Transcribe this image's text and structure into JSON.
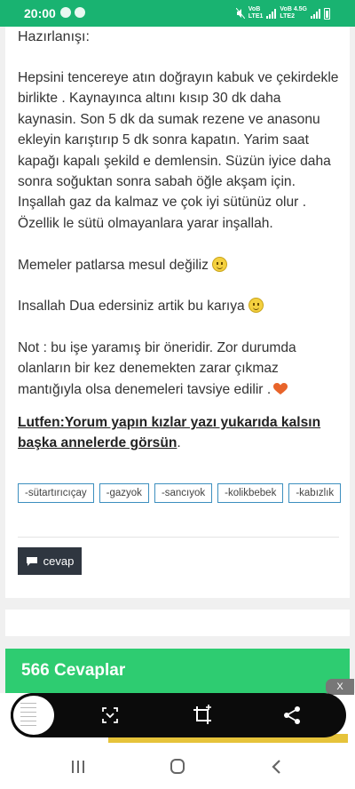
{
  "status_bar": {
    "time": "20:00",
    "network_1": "LTE1",
    "network_2": "LTE2",
    "net_label_1": "VoB",
    "net_label_2": "VoB 4.5G",
    "color": "#19b371"
  },
  "post": {
    "heading": "Hazırlanışı:",
    "paragraph_1": "Hepsini tencereye atın doğrayın kabuk ve çekirdekle birlikte . Kaynayınca altını kısıp 30 dk daha kaynasin. Son 5 dk da sumak rezene ve anasonu ekleyin karıştırıp 5 dk sonra kapatın. Yarim saat kapağı kapalı şekild e demlensin.  Süzün iyice daha sonra soğuktan sonra sabah öğle akşam için.  Inşallah gaz da kalmaz ve çok iyi sütünüz olur . Özellik le sütü olmayanlara yarar inşallah.",
    "paragraph_2": "Memeler patlarsa mesul değiliz",
    "paragraph_3": "Insallah Dua edersiniz artik bu karıya",
    "paragraph_4": "Not : bu işe yaramış bir öneridir.  Zor durumda olanların bir kez denemekten zarar çıkmaz mantığıyla olsa denemeleri tavsiye edilir .",
    "note_link": "Lutfen:Yorum yapın kızlar yazı yukarıda kalsın başka annelerde görsün",
    "note_suffix": ".",
    "emoji_icon": "smiley-icon",
    "heart_icon": "heart-icon"
  },
  "tags": [
    "-sütartırıcıçay",
    "-gazyok",
    "-sancıyok",
    "-kolikbebek",
    "-kabızlık"
  ],
  "reply_button": {
    "label": "cevap",
    "icon": "comment-icon"
  },
  "answers_bar": {
    "label": "566 Cevaplar",
    "color": "#2ecc71"
  },
  "ad_close": {
    "label": "X"
  },
  "screenshot_toolbar": {
    "tools": [
      "scroll-capture-icon",
      "crop-icon",
      "share-icon"
    ]
  },
  "nav_bar": {
    "buttons": [
      "recents-icon",
      "home-icon",
      "back-icon"
    ]
  }
}
